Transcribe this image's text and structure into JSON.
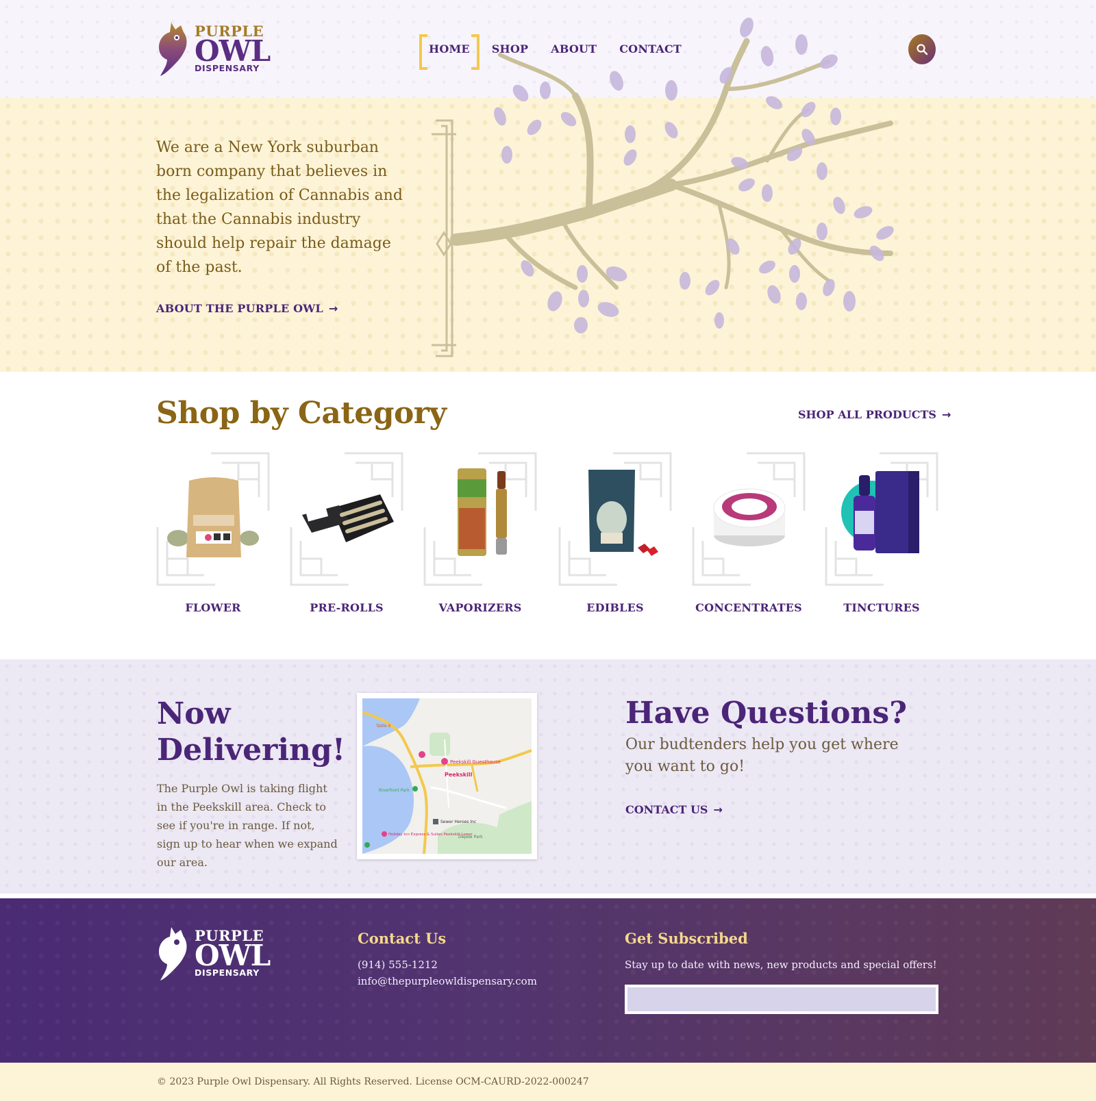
{
  "brand": {
    "line1": "PURPLE",
    "line2": "OWL",
    "line3": "DISPENSARY"
  },
  "nav": {
    "items": [
      {
        "label": "HOME",
        "active": true
      },
      {
        "label": "SHOP"
      },
      {
        "label": "ABOUT"
      },
      {
        "label": "CONTACT"
      }
    ],
    "search_icon": "search-icon"
  },
  "hero": {
    "text": "We are a New York suburban born company that believes in the legalization of Cannabis and that the Cannabis industry should help repair the damage of the past.",
    "link": "ABOUT THE PURPLE OWL"
  },
  "categories": {
    "title": "Shop by Category",
    "shop_all": "SHOP ALL PRODUCTS",
    "items": [
      {
        "label": "FLOWER"
      },
      {
        "label": "PRE-ROLLS"
      },
      {
        "label": "VAPORIZERS"
      },
      {
        "label": "EDIBLES"
      },
      {
        "label": "CONCENTRATES"
      },
      {
        "label": "TINCTURES"
      }
    ]
  },
  "delivery": {
    "title": "Now Delivering!",
    "text": "The Purple Owl is taking flight in the Peekskill area. Check to see if you're in range. If not, sign up to hear when we expand our area.",
    "map": {
      "town": "Peekskill",
      "places": [
        "Peekskill Guesthouse",
        "Riverfront Park",
        "Sewer Heroes Inc",
        "Holiday Inn Express & Suites Peekskill-Lower",
        "Depew Park",
        "Table 9"
      ]
    }
  },
  "questions": {
    "title": "Have Questions?",
    "text": "Our budtenders help you get where you want to go!",
    "link": "CONTACT US"
  },
  "footer": {
    "contact_title": "Contact Us",
    "phone": "(914) 555-1212",
    "email": "info@thepurpleowldispensary.com",
    "subscribe_title": "Get Subscribed",
    "subscribe_text": "Stay up to date with news, new products and special offers!",
    "subscribe_placeholder": ""
  },
  "copyright": "© 2023 Purple Owl Dispensary. All Rights Reserved. License OCM-CAURD-2022-000247",
  "colors": {
    "purple": "#4b2577",
    "gold": "#8a6515",
    "accent_yellow": "#f3c84c"
  }
}
